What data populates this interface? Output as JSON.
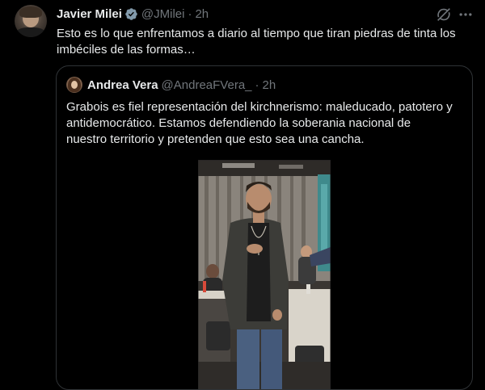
{
  "tweet": {
    "author_name": "Javier Milei",
    "author_handle": "@JMilei",
    "separator": "·",
    "time": "2h",
    "text": "Esto es lo que enfrentamos a diario al tiempo que tiran piedras de tinta los imbéciles de las formas…"
  },
  "quote": {
    "author_name": "Andrea Vera",
    "author_handle": "@AndreaFVera_",
    "separator": "·",
    "time": "2h",
    "text": "Grabois es fiel representación del kirchnerismo: maleducado, patotero y antidemocrático. Estamos defendiendo la soberania nacional de nuestro territorio y pretenden que esto sea una cancha."
  },
  "icons": {
    "verified": "verified-badge-icon",
    "grok": "grok-icon",
    "more": "more-horizontal-icon"
  },
  "colors": {
    "background": "#000000",
    "text": "#e7e9ea",
    "muted": "#71767b",
    "border": "#2f3336",
    "verified_badge": "#829aab"
  }
}
